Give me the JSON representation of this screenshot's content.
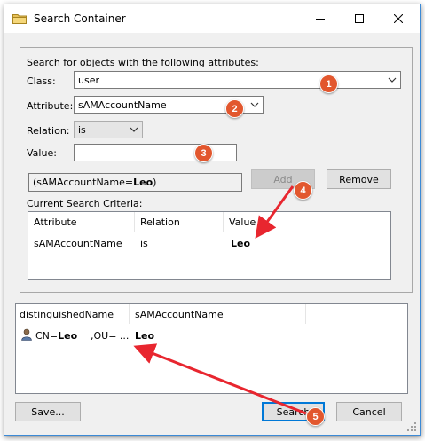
{
  "window": {
    "title": "Search Container"
  },
  "criteria_group": {
    "heading": "Search for objects with the following attributes:",
    "class_label": "Class:",
    "class_value": "user",
    "attribute_label": "Attribute:",
    "attribute_value": "sAMAccountName",
    "relation_label": "Relation:",
    "relation_value": "is",
    "value_label": "Value:",
    "value_text": "",
    "ldap_prefix": "(sAMAccountName=",
    "ldap_value": "Leo",
    "ldap_suffix": ")",
    "add_label": "Add",
    "remove_label": "Remove",
    "current_criteria_label": "Current Search Criteria:",
    "criteria_columns": [
      "Attribute",
      "Relation",
      "Value"
    ],
    "criteria_rows": [
      {
        "attribute": "sAMAccountName",
        "relation": "is",
        "value": "Leo"
      }
    ]
  },
  "results": {
    "columns": [
      "distinguishedName",
      "sAMAccountName"
    ],
    "rows": [
      {
        "dn_prefix": "CN=",
        "dn_name": "Leo",
        "dn_rest": ",OU= ...",
        "sam": "Leo"
      }
    ]
  },
  "footer": {
    "save_label": "Save...",
    "search_label": "Search",
    "cancel_label": "Cancel"
  },
  "annotations": [
    "1",
    "2",
    "3",
    "4",
    "5"
  ],
  "colors": {
    "badge": "#e2572e",
    "arrow": "#e8262f",
    "accent": "#0078d7"
  }
}
